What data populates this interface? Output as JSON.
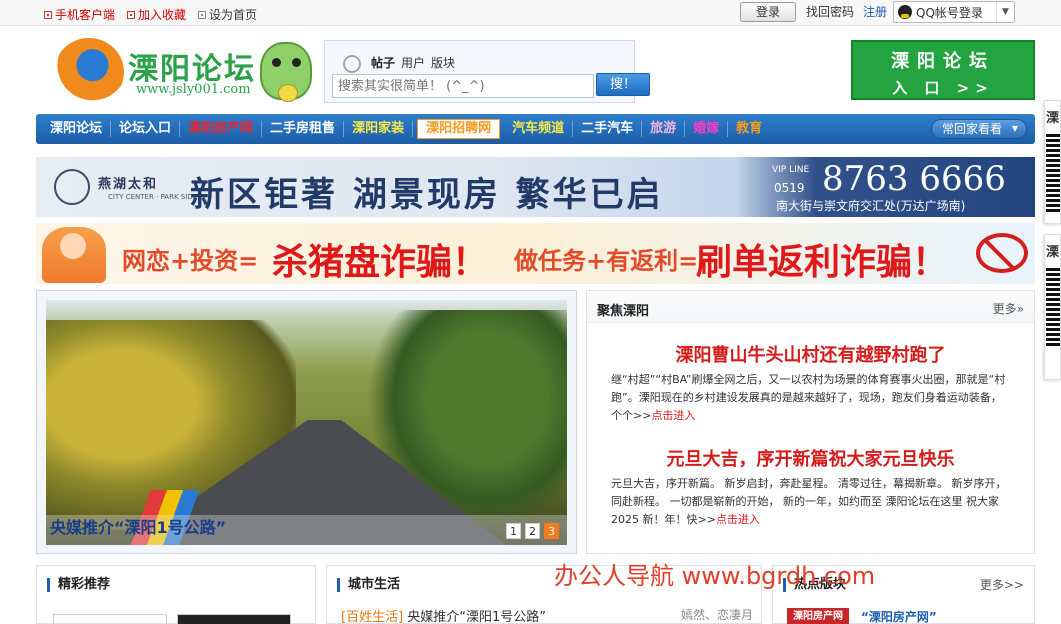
{
  "topbar": {
    "links": [
      "手机客户端",
      "加入收藏",
      "设为首页"
    ],
    "login_label": "登录",
    "find_password": "找回密码",
    "register": "注册",
    "qq_login": "QQ帐号登录"
  },
  "logo": {
    "title": "溧阳论坛",
    "url": "www.jsly001.com"
  },
  "search": {
    "tabs": [
      "帖子",
      "用户",
      "版块"
    ],
    "placeholder": "搜索其实很简单！ (^_^)",
    "button": "搜！"
  },
  "forum_entry": {
    "line1": "溧阳论坛",
    "line2": "入 口 >>"
  },
  "nav": {
    "items": [
      {
        "label": "溧阳论坛",
        "color": "#ffffff"
      },
      {
        "label": "论坛入口",
        "color": "#ffffff"
      },
      {
        "label": "溧阳房产网",
        "color": "#e8262c"
      },
      {
        "label": "二手房租售",
        "color": "#ffffff"
      },
      {
        "label": "溧阳家装",
        "color": "#f7e84a"
      },
      {
        "label": "溧阳招聘网",
        "color": "#f59a1f"
      },
      {
        "label": "汽车频道",
        "color": "#f7e84a"
      },
      {
        "label": "二手汽车",
        "color": "#ffffff"
      },
      {
        "label": "旅游",
        "color": "#f3b3e0"
      },
      {
        "label": "婚嫁",
        "color": "#ff39c8"
      },
      {
        "label": "教育",
        "color": "#f59a1f"
      }
    ],
    "more": "常回家看看"
  },
  "banner1": {
    "brand": "燕湖太和",
    "brand_sub": "CITY CENTER · PARK SIDE",
    "slogan": "新区钜著 湖景现房 繁华已启",
    "vip": "VIP LINE",
    "area_code": "0519",
    "phone": "8763 6666",
    "address": "南大街与崇文府交汇处(万达广场南)"
  },
  "banner2": {
    "part1": "网恋+投资=",
    "part2": "杀猪盘诈骗！",
    "part3": "做任务+有返利=",
    "part4": "刷单返利诈骗！"
  },
  "slideshow": {
    "caption": "央媒推介“溧阳1号公路”",
    "pages": [
      "1",
      "2",
      "3"
    ],
    "current": "3"
  },
  "focus": {
    "title": "聚焦溧阳",
    "more": "更多»",
    "articles": [
      {
        "title": "溧阳曹山牛头山村还有越野村跑了",
        "body": "继“村超”“村BA”刷爆全网之后，又一以农村为场景的体育赛事火出圈，那就是“村跑”。溧阳现在的乡村建设发展真的是越来越好了，现场，跑友们身着运动装备，个个>>",
        "link": "点击进入"
      },
      {
        "title": "元旦大吉，序开新篇祝大家元旦快乐",
        "body": "元旦大吉，序开新篇。 新岁启封，奔赴星程。 清零过往，幕揭新章。 新岁序开，同赴新程。 一切都是崭新的开始， 新的一年，如约而至 溧阳论坛在这里 祝大家2025 新！年！快>>",
        "link": "点击进入"
      }
    ]
  },
  "panels": {
    "featured": {
      "title": "精彩推荐"
    },
    "city": {
      "title": "城市生活",
      "category": "[百姓生活]",
      "row": "央媒推介“溧阳1号公路”",
      "meta": "嫣然、恋凄月"
    },
    "hot": {
      "title": "热点版块",
      "more": "更多>>",
      "img_text": "溧阳房产网",
      "link": "“溧阳房产网”"
    }
  },
  "watermark": "办公人导航 www.bgrdh.com",
  "sidefloat": {
    "top_char": "溧",
    "bottom_char": "溧"
  }
}
